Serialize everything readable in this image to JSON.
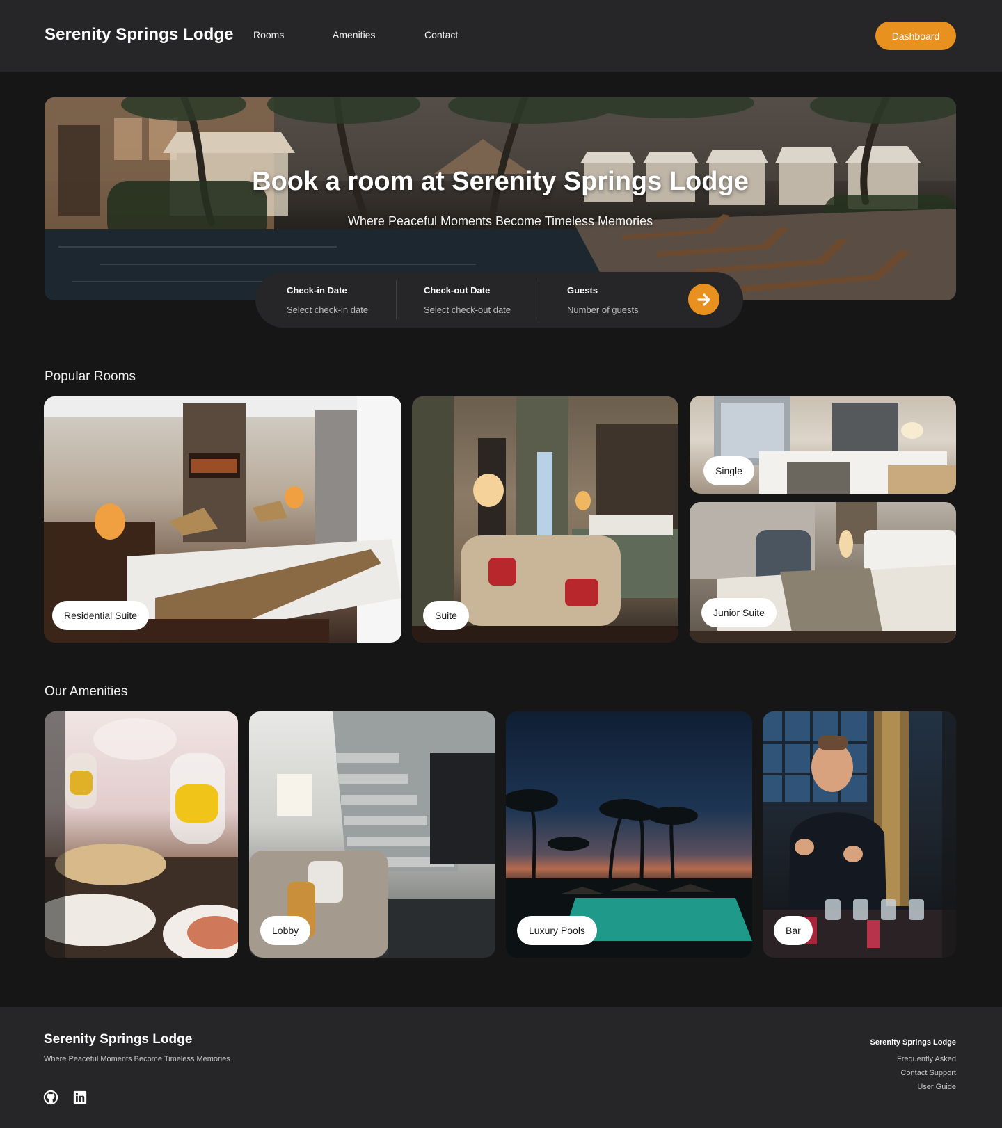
{
  "header": {
    "brand": "Serenity Springs Lodge",
    "nav": [
      "Rooms",
      "Amenities",
      "Contact"
    ],
    "dashboard_label": "Dashboard"
  },
  "hero": {
    "title": "Book a room at Serenity Springs Lodge",
    "subtitle": "Where Peaceful Moments Become Timeless Memories"
  },
  "booking": {
    "checkin_label": "Check-in Date",
    "checkin_placeholder": "Select check-in date",
    "checkout_label": "Check-out Date",
    "checkout_placeholder": "Select check-out date",
    "guests_label": "Guests",
    "guests_placeholder": "Number of guests",
    "submit_icon": "arrow-right-icon"
  },
  "rooms": {
    "title": "Popular Rooms",
    "items": [
      {
        "label": "Residential Suite"
      },
      {
        "label": "Suite"
      },
      {
        "label": "Single"
      },
      {
        "label": "Junior Suite"
      }
    ]
  },
  "amenities": {
    "title": "Our Amenities",
    "items": [
      {
        "label": ""
      },
      {
        "label": "Lobby"
      },
      {
        "label": "Luxury Pools"
      },
      {
        "label": "Bar"
      }
    ]
  },
  "footer": {
    "brand": "Serenity Springs Lodge",
    "tagline": "Where Peaceful Moments Become Timeless Memories",
    "social_icons": [
      "github-icon",
      "linkedin-icon"
    ],
    "column_title": "Serenity Springs Lodge",
    "links": [
      "Frequently Asked",
      "Contact Support",
      "User Guide"
    ]
  },
  "colors": {
    "accent": "#e8911f",
    "header_bg": "#262628",
    "page_bg": "#161616"
  }
}
